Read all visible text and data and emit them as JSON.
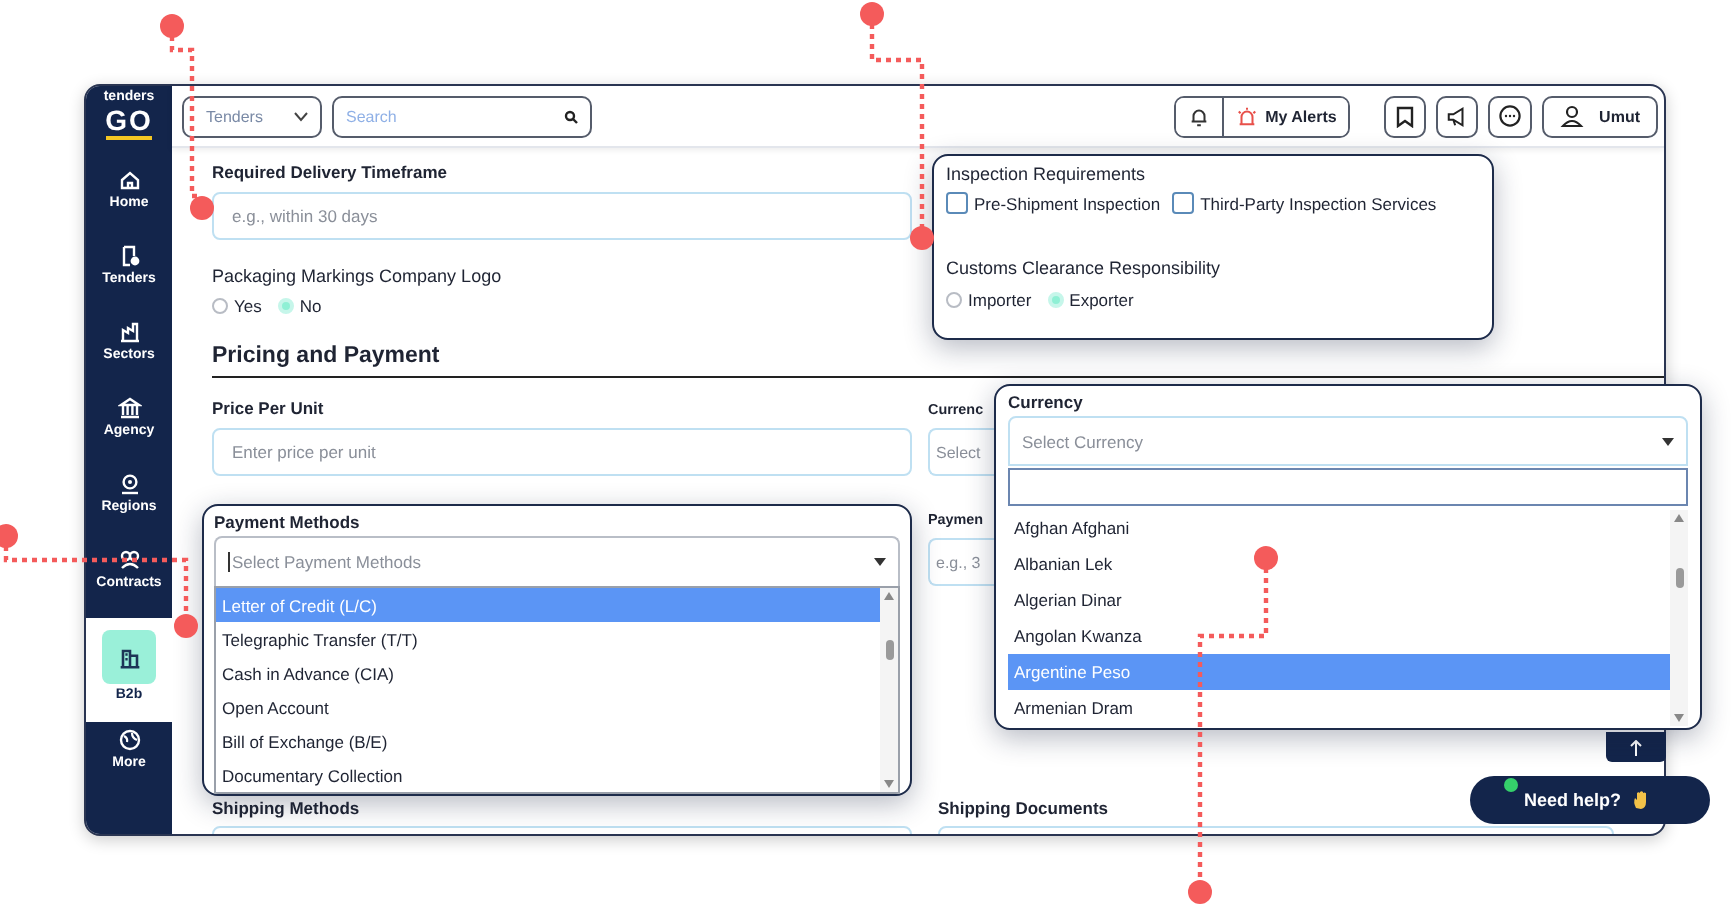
{
  "sidebar": {
    "logo": {
      "top": "tenders",
      "bottom": "GO"
    },
    "items": [
      {
        "label": "Home",
        "selected": false
      },
      {
        "label": "Tenders",
        "selected": false
      },
      {
        "label": "Sectors",
        "selected": false
      },
      {
        "label": "Agency",
        "selected": false
      },
      {
        "label": "Regions",
        "selected": false
      },
      {
        "label": "Contracts",
        "selected": false
      },
      {
        "label": "B2b",
        "selected": true
      },
      {
        "label": "More",
        "selected": false
      }
    ]
  },
  "topbar": {
    "category_select": {
      "value": "Tenders"
    },
    "search": {
      "placeholder": "Search"
    },
    "alerts_label": "My Alerts",
    "user_name": "Umut"
  },
  "form": {
    "delivery": {
      "label": "Required Delivery Timeframe",
      "placeholder": "e.g., within 30 days"
    },
    "logo_option": {
      "label": "Packaging Markings Company Logo",
      "options": [
        {
          "label": "Yes",
          "selected": false
        },
        {
          "label": "No",
          "selected": true
        }
      ]
    },
    "section_title": "Pricing and Payment",
    "price": {
      "label": "Price Per Unit",
      "placeholder": "Enter price per unit"
    },
    "currency_cut": {
      "label": "Currenc",
      "placeholder": "Select"
    },
    "payment_terms_cut": {
      "label": "Paymen",
      "placeholder": "e.g., 3"
    },
    "shipping_methods": {
      "label": "Shipping Methods"
    },
    "shipping_documents": {
      "label": "Shipping Documents"
    }
  },
  "inspection_popup": {
    "title": "Inspection Requirements",
    "checks": [
      {
        "label": "Pre-Shipment Inspection",
        "checked": false
      },
      {
        "label": "Third-Party Inspection Services",
        "checked": false
      }
    ],
    "customs_title": "Customs Clearance Responsibility",
    "customs_options": [
      {
        "label": "Importer",
        "selected": false
      },
      {
        "label": "Exporter",
        "selected": true
      }
    ]
  },
  "payment_popup": {
    "label": "Payment Methods",
    "placeholder": "Select Payment Methods",
    "options": [
      {
        "label": "Letter of Credit (L/C)",
        "selected": true
      },
      {
        "label": "Telegraphic Transfer (T/T)",
        "selected": false
      },
      {
        "label": "Cash in Advance (CIA)",
        "selected": false
      },
      {
        "label": "Open Account",
        "selected": false
      },
      {
        "label": "Bill of Exchange (B/E)",
        "selected": false
      },
      {
        "label": "Documentary Collection",
        "selected": false
      }
    ]
  },
  "currency_popup": {
    "label": "Currency",
    "placeholder": "Select Currency",
    "options": [
      {
        "label": "Afghan Afghani",
        "selected": false
      },
      {
        "label": "Albanian Lek",
        "selected": false
      },
      {
        "label": "Algerian Dinar",
        "selected": false
      },
      {
        "label": "Angolan Kwanza",
        "selected": false
      },
      {
        "label": "Argentine Peso",
        "selected": true
      },
      {
        "label": "Armenian Dram",
        "selected": false
      }
    ]
  },
  "help": {
    "label": "Need help?",
    "online": true
  }
}
